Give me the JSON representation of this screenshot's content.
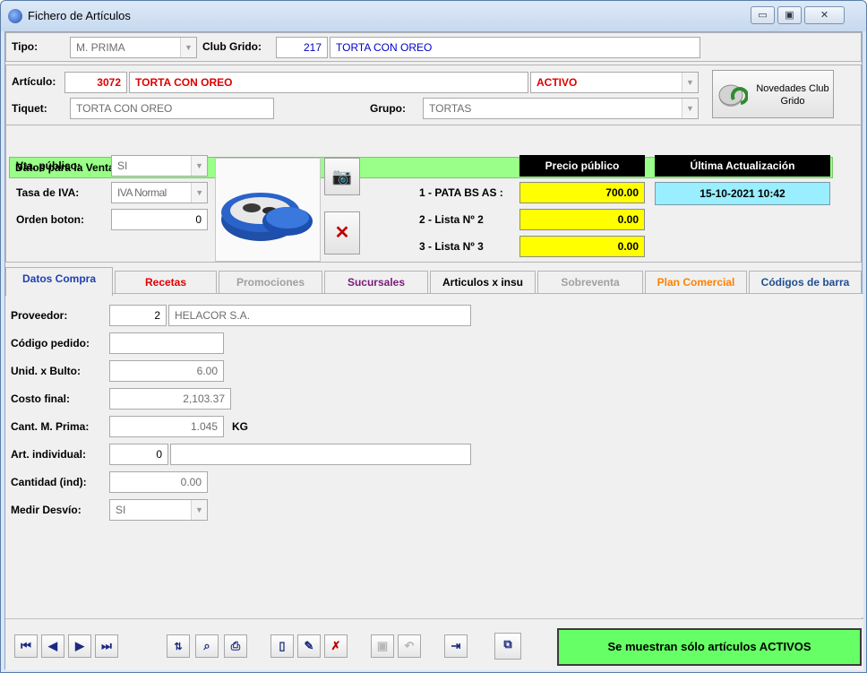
{
  "window": {
    "title": "Fichero de Artículos",
    "controls": {
      "minimize": "▭",
      "maximize": "▣",
      "close": "✕"
    }
  },
  "header": {
    "tipo_label": "Tipo:",
    "tipo_value": "M. PRIMA",
    "club_label": "Club Grido:",
    "club_code": "217",
    "club_name": "TORTA CON OREO"
  },
  "articulo": {
    "label": "Artículo:",
    "code": "3072",
    "name": "TORTA CON OREO",
    "status": "ACTIVO",
    "tiquet_label": "Tiquet:",
    "tiquet_value": "TORTA CON OREO",
    "grupo_label": "Grupo:",
    "grupo_value": "TORTAS",
    "novedades_label": "Novedades Club Grido"
  },
  "venta": {
    "section_title": "Datos para la Venta",
    "vta_publico_label": "Vta. público:",
    "vta_publico_value": "SI",
    "tasa_iva_label": "Tasa de IVA:",
    "tasa_iva_value": "IVA Normal",
    "orden_boton_label": "Orden boton:",
    "orden_boton_value": "0",
    "precio_publico_header": "Precio público",
    "ultima_act_header": "Última Actualización",
    "ultima_act_value": "15-10-2021 10:42",
    "prices": [
      {
        "label": "1 - PATA BS AS :",
        "value": "700.00"
      },
      {
        "label": "2 - Lista Nº 2",
        "value": "0.00"
      },
      {
        "label": "3 - Lista Nº 3",
        "value": "0.00"
      }
    ]
  },
  "tabs": [
    {
      "label": "Datos Compra",
      "color": "#1f3fb0"
    },
    {
      "label": "Recetas",
      "color": "#e00000"
    },
    {
      "label": "Promociones",
      "color": "#a0a0a0"
    },
    {
      "label": "Sucursales",
      "color": "#7a1a7a"
    },
    {
      "label": "Articulos x insu",
      "color": "#000000"
    },
    {
      "label": "Sobreventa",
      "color": "#a0a0a0"
    },
    {
      "label": "Plan Comercial",
      "color": "#ff8000"
    },
    {
      "label": "Códigos de barra",
      "color": "#1f4f8f"
    }
  ],
  "compra": {
    "proveedor_label": "Proveedor:",
    "proveedor_code": "2",
    "proveedor_name": "HELACOR S.A.",
    "codigo_pedido_label": "Código pedido:",
    "codigo_pedido_value": "",
    "unid_bulto_label": "Unid. x Bulto:",
    "unid_bulto_value": "6.00",
    "costo_final_label": "Costo final:",
    "costo_final_value": "2,103.37",
    "cant_mprima_label": "Cant. M. Prima:",
    "cant_mprima_value": "1.045",
    "cant_mprima_unit": "KG",
    "art_individual_label": "Art. individual:",
    "art_individual_code": "0",
    "art_individual_name": "",
    "cantidad_ind_label": "Cantidad (ind):",
    "cantidad_ind_value": "0.00",
    "medir_desvio_label": "Medir Desvío:",
    "medir_desvio_value": "SI"
  },
  "footer": {
    "status_button": "Se muestran sólo artículos ACTIVOS"
  }
}
